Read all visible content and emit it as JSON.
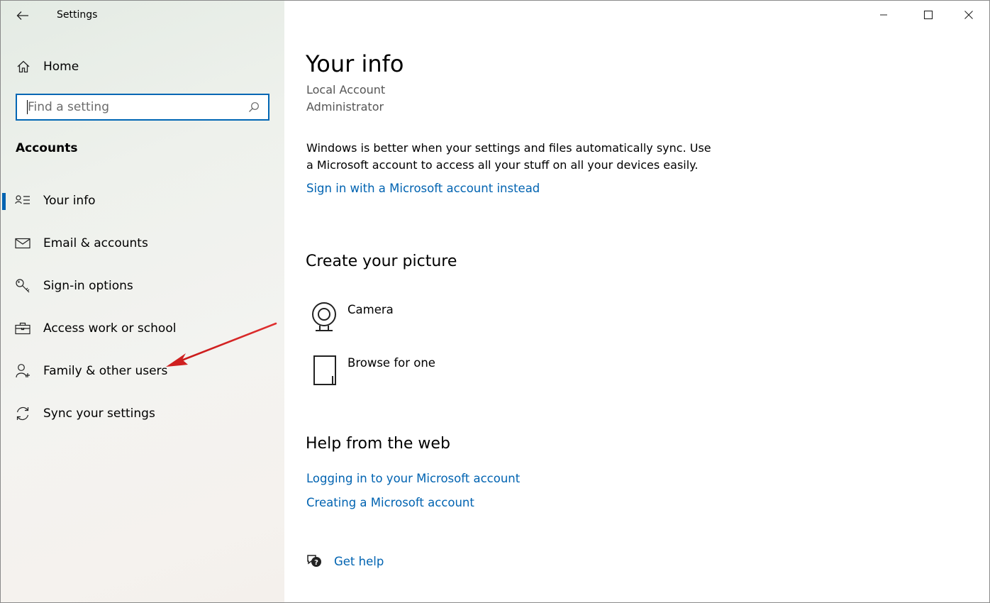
{
  "window": {
    "title": "Settings"
  },
  "sidebar": {
    "home_label": "Home",
    "search_placeholder": "Find a setting",
    "section_heading": "Accounts",
    "items": [
      {
        "label": "Your info",
        "icon": "contact-info-icon",
        "selected": true
      },
      {
        "label": "Email & accounts",
        "icon": "mail-icon",
        "selected": false
      },
      {
        "label": "Sign-in options",
        "icon": "key-icon",
        "selected": false
      },
      {
        "label": "Access work or school",
        "icon": "briefcase-icon",
        "selected": false
      },
      {
        "label": "Family & other users",
        "icon": "add-person-icon",
        "selected": false
      },
      {
        "label": "Sync your settings",
        "icon": "sync-icon",
        "selected": false
      }
    ],
    "annotation_arrow_color": "#d0201f"
  },
  "main": {
    "title": "Your info",
    "account_type": "Local Account",
    "role": "Administrator",
    "sync_message": "Windows is better when your settings and files automatically sync. Use a Microsoft account to access all your stuff on all your devices easily.",
    "sign_in_link": "Sign in with a Microsoft account instead",
    "picture_heading": "Create your picture",
    "picture_options": [
      {
        "label": "Camera",
        "icon": "webcam-icon"
      },
      {
        "label": "Browse for one",
        "icon": "file-icon"
      }
    ],
    "help_heading": "Help from the web",
    "help_links": [
      "Logging in to your Microsoft account",
      "Creating a Microsoft account"
    ],
    "get_help_label": "Get help"
  },
  "colors": {
    "accent": "#0063b1",
    "link": "#0063b1",
    "search_border": "#0066b4"
  }
}
